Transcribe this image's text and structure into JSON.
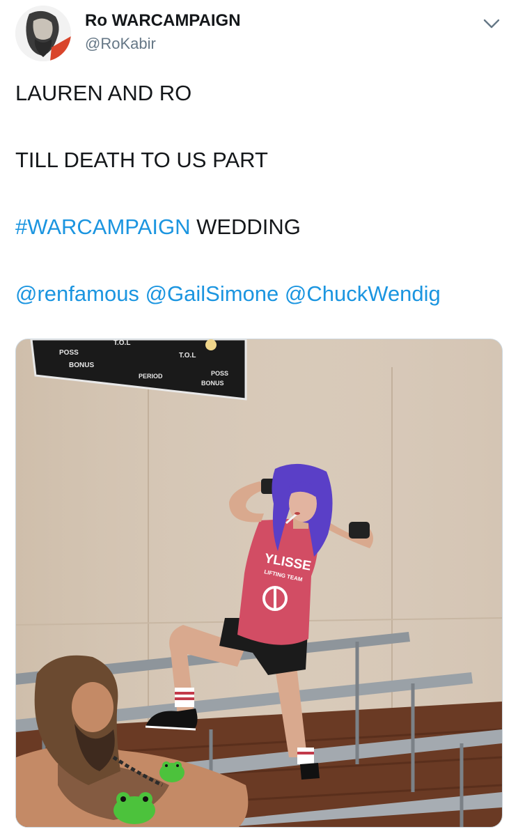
{
  "author": {
    "display_name": "Ro WARCAMPAIGN",
    "handle": "@RoKabir",
    "avatar_icon": "avatar-image"
  },
  "menu_icon": "chevron-down-icon",
  "tweet": {
    "line1": "LAUREN AND RO",
    "line2": "TILL DEATH TO US PART",
    "hashtag": "#WARCAMPAIGN",
    "hashtag_rest": " WEDDING",
    "mentions": [
      "@renfamous",
      "@GailSimone",
      "@ChuckWendig"
    ]
  },
  "media": {
    "scoreboard": {
      "tol": "T.O.L",
      "poss_left": "POSS",
      "bonus_left": "BONUS",
      "period": "PERIOD",
      "tol_right": "T.O.L",
      "poss_right": "POSS",
      "bonus_right": "BONUS"
    },
    "shirt_text": "YLISSE",
    "shirt_subtext": "LIFTING TEAM"
  },
  "colors": {
    "link": "#1b95e0",
    "text": "#14171a",
    "muted": "#657786",
    "border": "#ccd6dd"
  }
}
